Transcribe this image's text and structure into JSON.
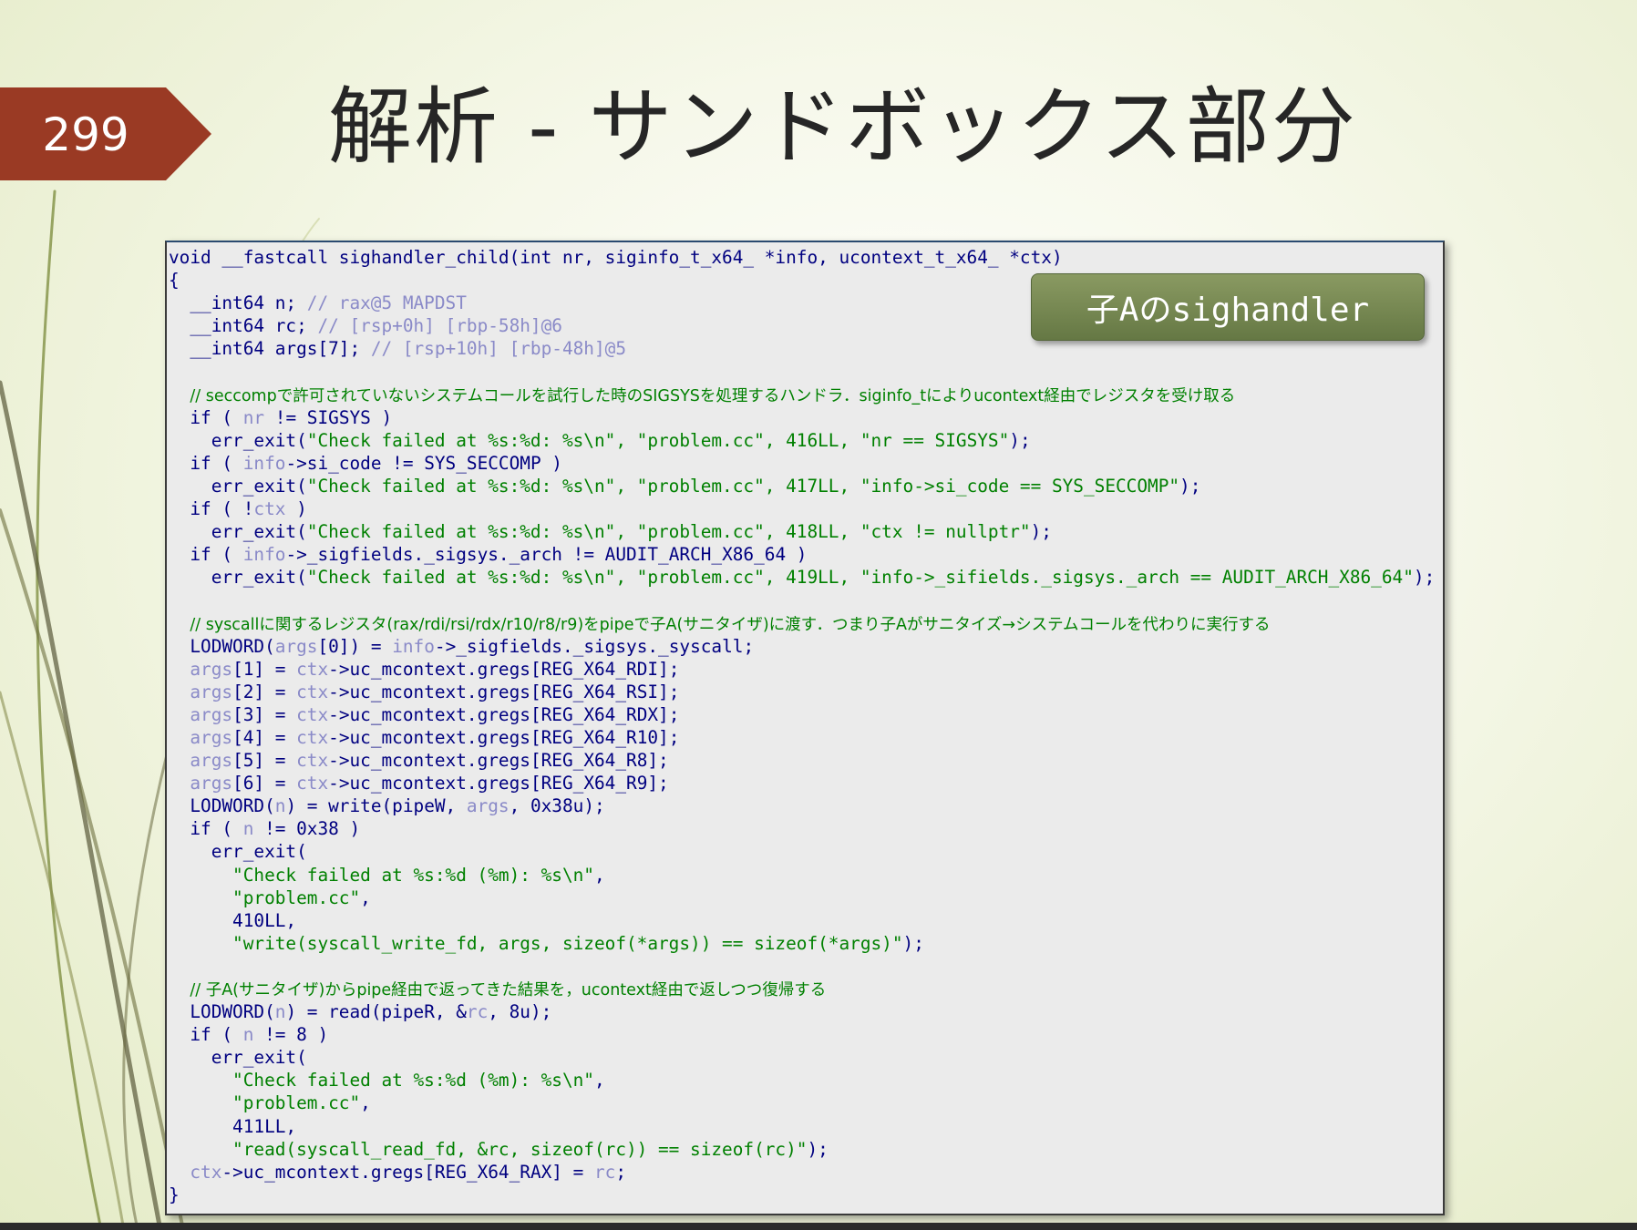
{
  "slide": {
    "number": "299",
    "title": "解析 - サンドボックス部分",
    "badge": "子Aのsighandler"
  },
  "code": {
    "lines": [
      [
        {
          "t": "void __fastcall sighandler_child(int nr, siginfo_t_x64_ *info, ucontext_t_x64_ *ctx)",
          "c": "kw"
        }
      ],
      [
        {
          "t": "{",
          "c": "kw"
        }
      ],
      [
        {
          "t": "  __int64 n; ",
          "c": "kw"
        },
        {
          "t": "// rax@5 MAPDST",
          "c": "cm-meta"
        }
      ],
      [
        {
          "t": "  __int64 rc; ",
          "c": "kw"
        },
        {
          "t": "// [rsp+0h] [rbp-58h]@6",
          "c": "cm-meta"
        }
      ],
      [
        {
          "t": "  __int64 args[7]; ",
          "c": "kw"
        },
        {
          "t": "// [rsp+10h] [rbp-48h]@5",
          "c": "cm-meta"
        }
      ],
      [
        {
          "t": "",
          "c": "kw"
        }
      ],
      [
        {
          "t": "  ",
          "c": "kw"
        },
        {
          "t": "// seccompで許可されていないシステムコールを試行した時のSIGSYSを処理するハンドラ．siginfo_tによりucontext経由でレジスタを受け取る",
          "c": "cm"
        }
      ],
      [
        {
          "t": "  if ( ",
          "c": "kw"
        },
        {
          "t": "nr",
          "c": "vr"
        },
        {
          "t": " != SIGSYS )",
          "c": "kw"
        }
      ],
      [
        {
          "t": "    err_exit(",
          "c": "kw"
        },
        {
          "t": "\"Check failed at %s:%d: %s\\n\", \"problem.cc\", 416LL, \"nr == SIGSYS\"",
          "c": "st"
        },
        {
          "t": ");",
          "c": "kw"
        }
      ],
      [
        {
          "t": "  if ( ",
          "c": "kw"
        },
        {
          "t": "info",
          "c": "vr"
        },
        {
          "t": "->si_code != SYS_SECCOMP )",
          "c": "kw"
        }
      ],
      [
        {
          "t": "    err_exit(",
          "c": "kw"
        },
        {
          "t": "\"Check failed at %s:%d: %s\\n\", \"problem.cc\", 417LL, \"info->si_code == SYS_SECCOMP\"",
          "c": "st"
        },
        {
          "t": ");",
          "c": "kw"
        }
      ],
      [
        {
          "t": "  if ( !",
          "c": "kw"
        },
        {
          "t": "ctx",
          "c": "vr"
        },
        {
          "t": " )",
          "c": "kw"
        }
      ],
      [
        {
          "t": "    err_exit(",
          "c": "kw"
        },
        {
          "t": "\"Check failed at %s:%d: %s\\n\", \"problem.cc\", 418LL, \"ctx != nullptr\"",
          "c": "st"
        },
        {
          "t": ");",
          "c": "kw"
        }
      ],
      [
        {
          "t": "  if ( ",
          "c": "kw"
        },
        {
          "t": "info",
          "c": "vr"
        },
        {
          "t": "->_sigfields._sigsys._arch != AUDIT_ARCH_X86_64 )",
          "c": "kw"
        }
      ],
      [
        {
          "t": "    err_exit(",
          "c": "kw"
        },
        {
          "t": "\"Check failed at %s:%d: %s\\n\", \"problem.cc\", 419LL, \"info->_sifields._sigsys._arch == AUDIT_ARCH_X86_64\"",
          "c": "st"
        },
        {
          "t": ");",
          "c": "kw"
        }
      ],
      [
        {
          "t": "",
          "c": "kw"
        }
      ],
      [
        {
          "t": "  ",
          "c": "kw"
        },
        {
          "t": "// syscallに関するレジスタ(rax/rdi/rsi/rdx/r10/r8/r9)をpipeで子A(サニタイザ)に渡す．つまり子Aがサニタイズ→システムコールを代わりに実行する",
          "c": "cm"
        }
      ],
      [
        {
          "t": "  LODWORD(",
          "c": "kw"
        },
        {
          "t": "args",
          "c": "vr"
        },
        {
          "t": "[0]) = ",
          "c": "kw"
        },
        {
          "t": "info",
          "c": "vr"
        },
        {
          "t": "->_sigfields._sigsys._syscall;",
          "c": "kw"
        }
      ],
      [
        {
          "t": "  ",
          "c": "kw"
        },
        {
          "t": "args",
          "c": "vr"
        },
        {
          "t": "[1] = ",
          "c": "kw"
        },
        {
          "t": "ctx",
          "c": "vr"
        },
        {
          "t": "->uc_mcontext.gregs[REG_X64_RDI];",
          "c": "kw"
        }
      ],
      [
        {
          "t": "  ",
          "c": "kw"
        },
        {
          "t": "args",
          "c": "vr"
        },
        {
          "t": "[2] = ",
          "c": "kw"
        },
        {
          "t": "ctx",
          "c": "vr"
        },
        {
          "t": "->uc_mcontext.gregs[REG_X64_RSI];",
          "c": "kw"
        }
      ],
      [
        {
          "t": "  ",
          "c": "kw"
        },
        {
          "t": "args",
          "c": "vr"
        },
        {
          "t": "[3] = ",
          "c": "kw"
        },
        {
          "t": "ctx",
          "c": "vr"
        },
        {
          "t": "->uc_mcontext.gregs[REG_X64_RDX];",
          "c": "kw"
        }
      ],
      [
        {
          "t": "  ",
          "c": "kw"
        },
        {
          "t": "args",
          "c": "vr"
        },
        {
          "t": "[4] = ",
          "c": "kw"
        },
        {
          "t": "ctx",
          "c": "vr"
        },
        {
          "t": "->uc_mcontext.gregs[REG_X64_R10];",
          "c": "kw"
        }
      ],
      [
        {
          "t": "  ",
          "c": "kw"
        },
        {
          "t": "args",
          "c": "vr"
        },
        {
          "t": "[5] = ",
          "c": "kw"
        },
        {
          "t": "ctx",
          "c": "vr"
        },
        {
          "t": "->uc_mcontext.gregs[REG_X64_R8];",
          "c": "kw"
        }
      ],
      [
        {
          "t": "  ",
          "c": "kw"
        },
        {
          "t": "args",
          "c": "vr"
        },
        {
          "t": "[6] = ",
          "c": "kw"
        },
        {
          "t": "ctx",
          "c": "vr"
        },
        {
          "t": "->uc_mcontext.gregs[REG_X64_R9];",
          "c": "kw"
        }
      ],
      [
        {
          "t": "  LODWORD(",
          "c": "kw"
        },
        {
          "t": "n",
          "c": "vr"
        },
        {
          "t": ") = write(pipeW, ",
          "c": "kw"
        },
        {
          "t": "args",
          "c": "vr"
        },
        {
          "t": ", 0x38u);",
          "c": "kw"
        }
      ],
      [
        {
          "t": "  if ( ",
          "c": "kw"
        },
        {
          "t": "n",
          "c": "vr"
        },
        {
          "t": " != 0x38 )",
          "c": "kw"
        }
      ],
      [
        {
          "t": "    err_exit(",
          "c": "kw"
        }
      ],
      [
        {
          "t": "      ",
          "c": "kw"
        },
        {
          "t": "\"Check failed at %s:%d (%m): %s\\n\"",
          "c": "st"
        },
        {
          "t": ",",
          "c": "kw"
        }
      ],
      [
        {
          "t": "      ",
          "c": "kw"
        },
        {
          "t": "\"problem.cc\"",
          "c": "st"
        },
        {
          "t": ",",
          "c": "kw"
        }
      ],
      [
        {
          "t": "      410LL,",
          "c": "kw"
        }
      ],
      [
        {
          "t": "      ",
          "c": "kw"
        },
        {
          "t": "\"write(syscall_write_fd, args, sizeof(*args)) == sizeof(*args)\"",
          "c": "st"
        },
        {
          "t": ");",
          "c": "kw"
        }
      ],
      [
        {
          "t": "",
          "c": "kw"
        }
      ],
      [
        {
          "t": "  ",
          "c": "kw"
        },
        {
          "t": "// 子A(サニタイザ)からpipe経由で返ってきた結果を，ucontext経由で返しつつ復帰する",
          "c": "cm"
        }
      ],
      [
        {
          "t": "  LODWORD(",
          "c": "kw"
        },
        {
          "t": "n",
          "c": "vr"
        },
        {
          "t": ") = read(pipeR, &",
          "c": "kw"
        },
        {
          "t": "rc",
          "c": "vr"
        },
        {
          "t": ", 8u);",
          "c": "kw"
        }
      ],
      [
        {
          "t": "  if ( ",
          "c": "kw"
        },
        {
          "t": "n",
          "c": "vr"
        },
        {
          "t": " != 8 )",
          "c": "kw"
        }
      ],
      [
        {
          "t": "    err_exit(",
          "c": "kw"
        }
      ],
      [
        {
          "t": "      ",
          "c": "kw"
        },
        {
          "t": "\"Check failed at %s:%d (%m): %s\\n\"",
          "c": "st"
        },
        {
          "t": ",",
          "c": "kw"
        }
      ],
      [
        {
          "t": "      ",
          "c": "kw"
        },
        {
          "t": "\"problem.cc\"",
          "c": "st"
        },
        {
          "t": ",",
          "c": "kw"
        }
      ],
      [
        {
          "t": "      411LL,",
          "c": "kw"
        }
      ],
      [
        {
          "t": "      ",
          "c": "kw"
        },
        {
          "t": "\"read(syscall_read_fd, &rc, sizeof(rc)) == sizeof(rc)\"",
          "c": "st"
        },
        {
          "t": ");",
          "c": "kw"
        }
      ],
      [
        {
          "t": "  ",
          "c": "kw"
        },
        {
          "t": "ctx",
          "c": "vr"
        },
        {
          "t": "->uc_mcontext.gregs[REG_X64_RAX] = ",
          "c": "kw"
        },
        {
          "t": "rc",
          "c": "vr"
        },
        {
          "t": ";",
          "c": "kw"
        }
      ],
      [
        {
          "t": "}",
          "c": "kw"
        }
      ]
    ]
  },
  "colors": {
    "tag": "#9a3a24",
    "badge": "#6f8048",
    "code_text": "#000080",
    "code_comment": "#008000",
    "code_variable": "#8a8ac8"
  }
}
